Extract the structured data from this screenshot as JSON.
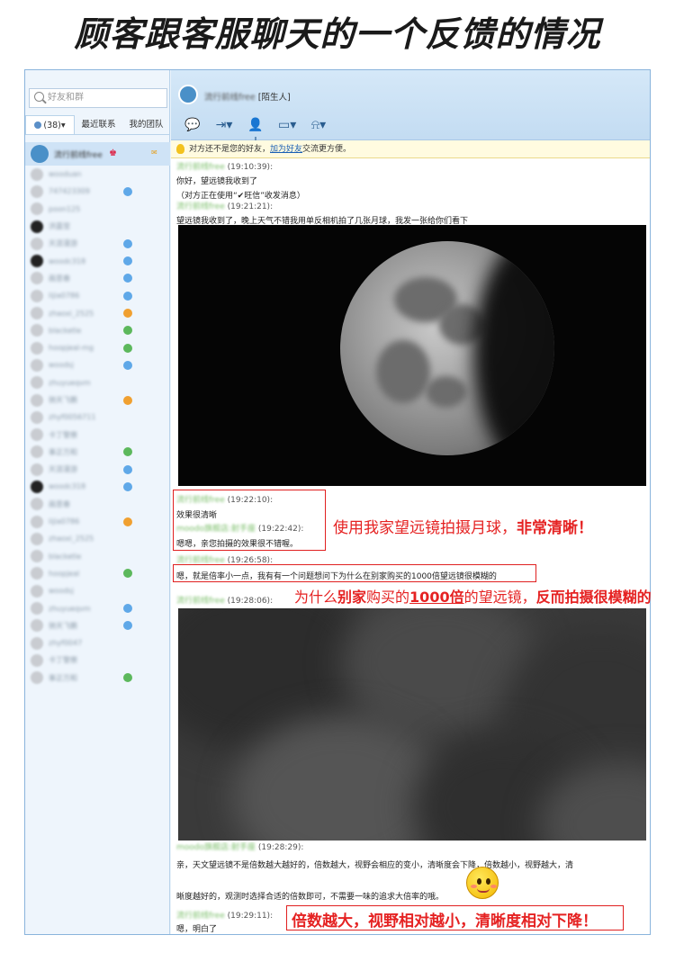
{
  "headline": "顾客跟客服聊天的一个反馈的情况",
  "sidebar": {
    "search_placeholder": "好友和群",
    "tabs": [
      {
        "label": "(38)▾"
      },
      {
        "label": "最近联系"
      },
      {
        "label": "我的团队"
      }
    ],
    "first_contact": "流行前线free",
    "contacts": [
      "wooduan",
      "747423309",
      "poon125",
      "洪嘉莹",
      "天涯漫游",
      "woodc318",
      "画意春",
      "lijia0786",
      "zhaoxi_2525",
      "blacketle",
      "hoopjeal-mg",
      "woodsj",
      "zhuyueqvm",
      "驰天飞鹏",
      "zhyf0056711",
      "卡丁警察",
      "事正万和",
      "天涯漫游",
      "woodc318",
      "画意春",
      "lijia0786",
      "zhaoxi_2525",
      "blacketle",
      "hoopjeal",
      "woodsj",
      "zhuyueqvm",
      "驰天飞鹏",
      "zhyf0047",
      "卡丁警察",
      "事正万和"
    ]
  },
  "chat": {
    "peer_name": "流行前线free",
    "peer_tag": "[陌生人]",
    "notice_prefix": "对方还不是您的好友，",
    "notice_link": "加为好友",
    "notice_suffix": "交流更方便。",
    "messages": [
      {
        "sender": "流行前线free",
        "time": "(19:10:39):",
        "lines": [
          "你好，望远镜我收到了",
          "（对方正在使用“✔旺信”收发消息）"
        ]
      },
      {
        "sender": "流行前线free",
        "time": "(19:21:21):",
        "lines": [
          "望远镜我收到了，晚上天气不错我用单反相机拍了几张月球，我发一张给你们看下"
        ]
      },
      {
        "sender": "流行前线free",
        "time": "(19:22:10):",
        "lines": [
          "效果很清晰"
        ]
      },
      {
        "sender": "moodo旗舰店:射手座",
        "time": "(19:22:42):",
        "lines": [
          "嗯嗯，亲您拍摄的效果很不错喔。"
        ]
      },
      {
        "sender": "流行前线free",
        "time": "(19:26:58):",
        "lines": [
          "嗯，就是倍率小一点，我有有一个问题想问下为什么在别家购买的1000倍望远镜很模糊的"
        ]
      },
      {
        "sender": "流行前线free",
        "time": "(19:28:06):",
        "lines": []
      },
      {
        "sender": "moodo旗舰店:射手座",
        "time": "(19:28:29):",
        "lines": [
          "亲，天文望远镜不是倍数越大越好的，倍数越大，视野会相应的变小，清晰度会下降，倍数越小，视野越大，清",
          "晰度越好的，观测时选择合适的倍数即可，不需要一味的追求大倍率的哦。"
        ]
      },
      {
        "sender": "流行前线free",
        "time": "(19:29:11):",
        "lines": [
          "嗯，明白了"
        ]
      }
    ]
  },
  "annotations": {
    "a1_prefix": "使用我家望远镜拍摄月球，",
    "a1_bold": "非常清晰！",
    "a2_p1": "为什么",
    "a2_b1": "别家",
    "a2_p2": "购买的",
    "a2_u": "1000倍",
    "a2_p3": "的望远镜，",
    "a2_b2": "反而拍摄很模糊的",
    "a3": "倍数越大，视野相对越小，清晰度相对下降！"
  }
}
